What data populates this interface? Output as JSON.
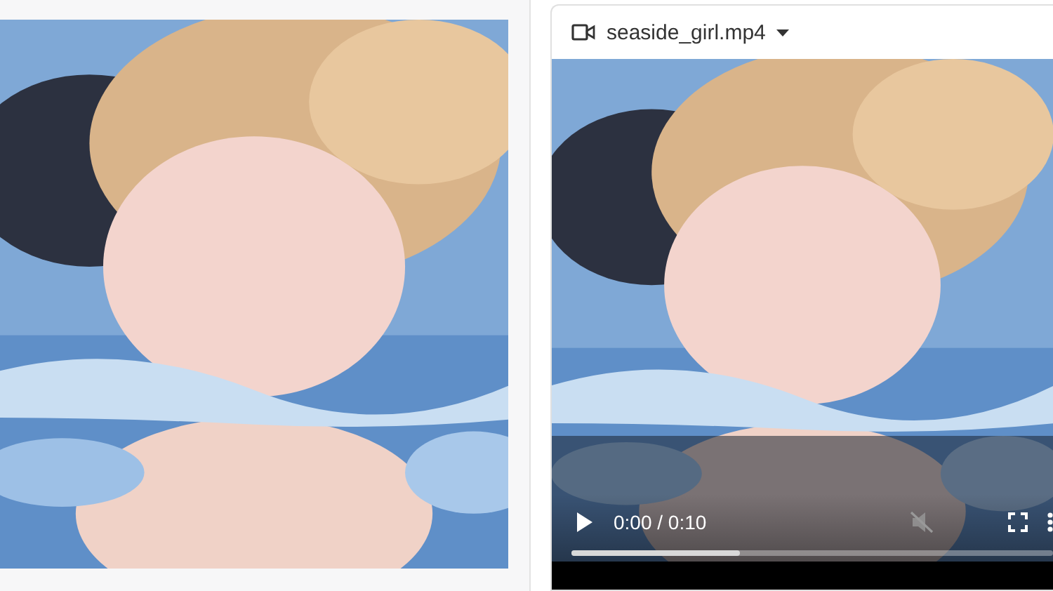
{
  "video": {
    "file_name": "seaside_girl.mp4",
    "time": "0:00 / 0:10",
    "playing": false,
    "muted": true,
    "progress": {
      "level": 0.35
    }
  }
}
